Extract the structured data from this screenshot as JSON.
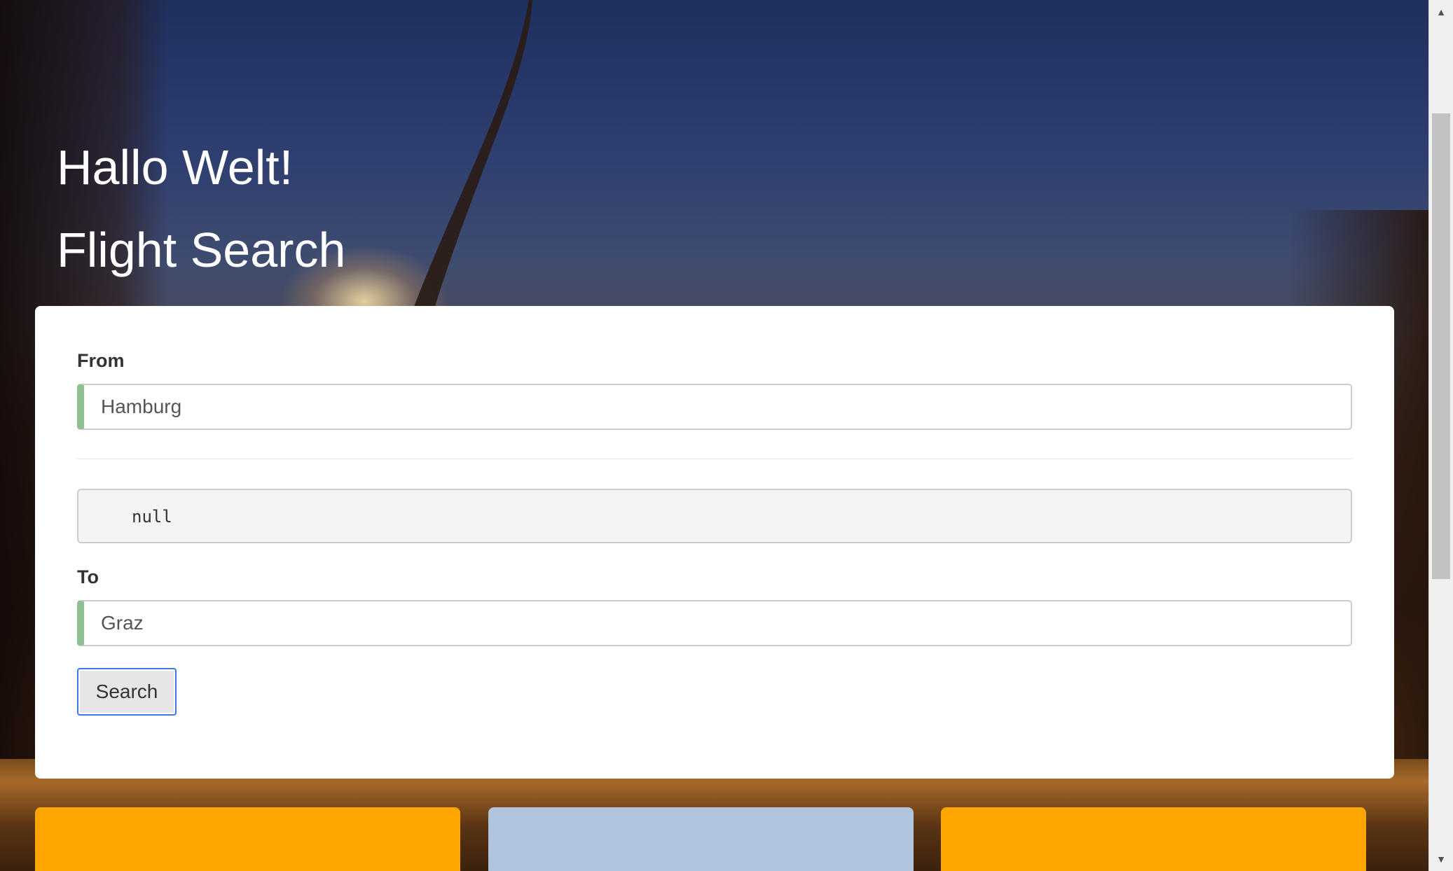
{
  "header": {
    "greeting": "Hallo Welt!",
    "title": "Flight Search"
  },
  "form": {
    "from_label": "From",
    "from_value": "Hamburg",
    "debug_output": "null",
    "to_label": "To",
    "to_value": "Graz",
    "search_button_label": "Search"
  },
  "colors": {
    "valid_indicator": "#8fc08f",
    "tile_orange": "#ffa500",
    "tile_blue": "#b0c4de",
    "focus_ring": "#3b78e7"
  },
  "icons": {
    "scroll_up": "triangle-up-icon",
    "scroll_down": "triangle-down-icon"
  }
}
